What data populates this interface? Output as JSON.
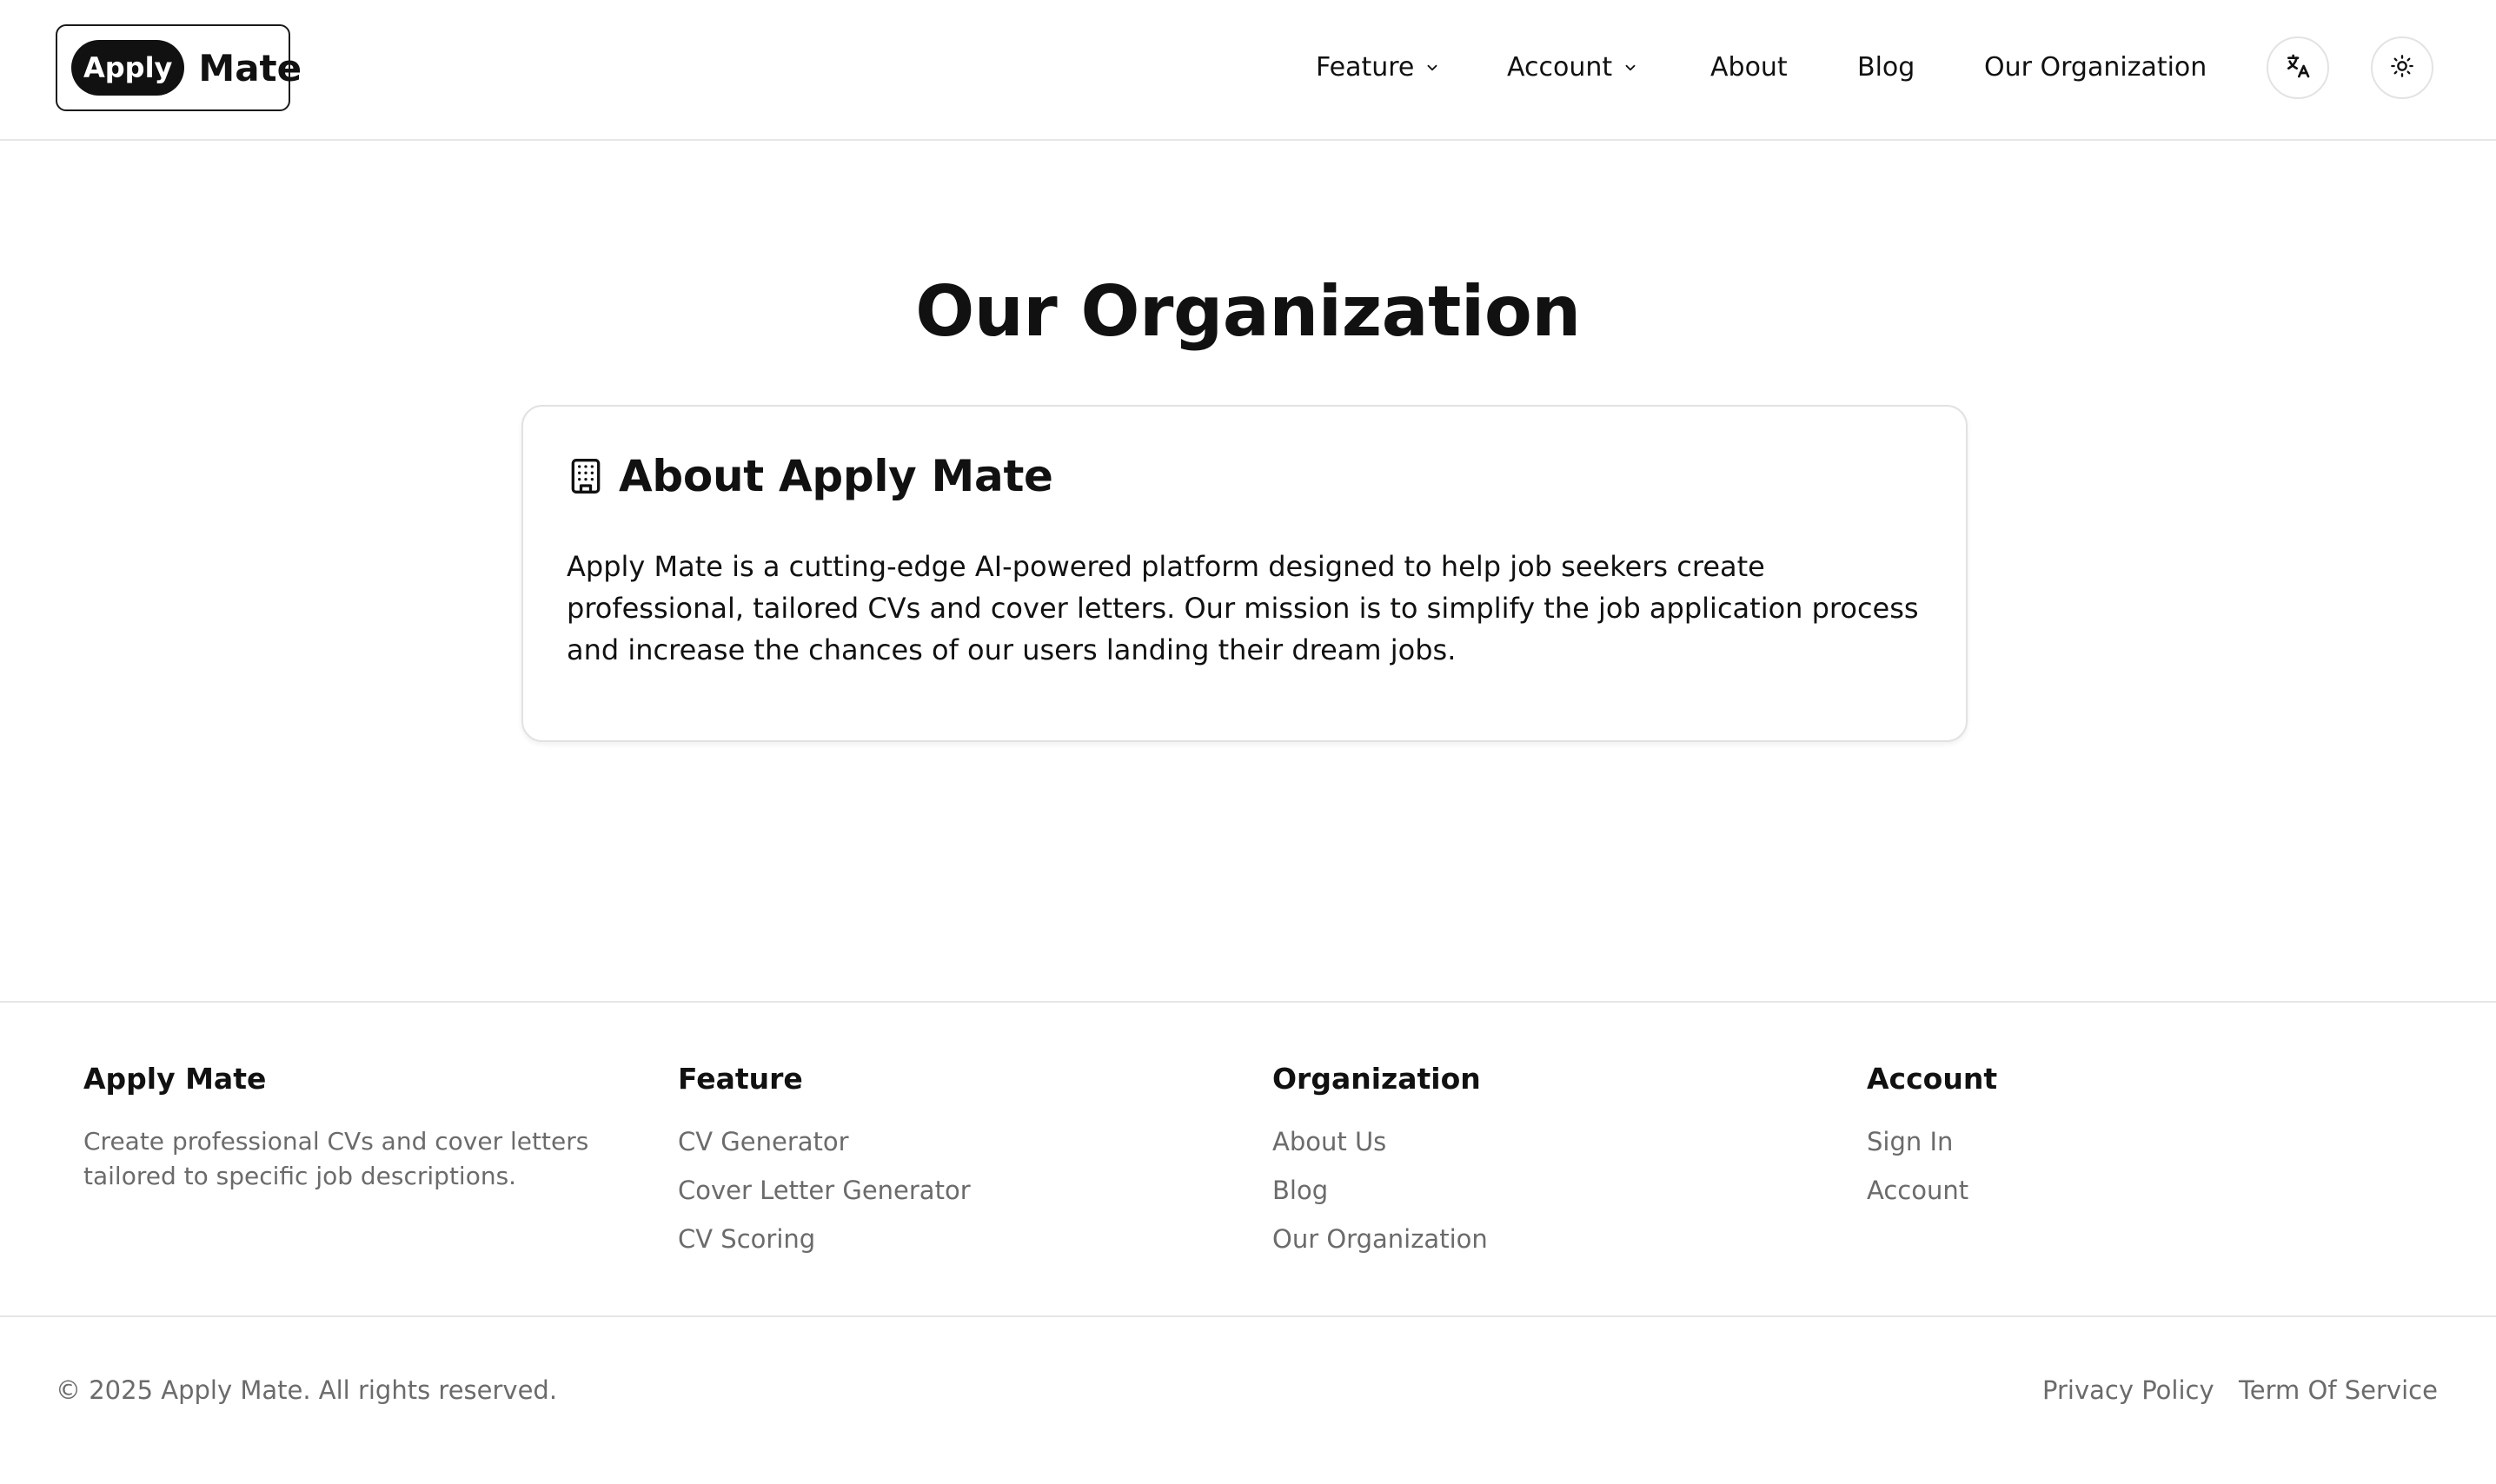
{
  "brand": {
    "pill": "Apply",
    "word": "Mate"
  },
  "nav": {
    "feature": "Feature",
    "account": "Account",
    "about": "About",
    "blog": "Blog",
    "organization": "Our Organization",
    "icons": {
      "translate": "translate-icon",
      "theme": "sun-icon",
      "dropdown": "chevron-down-icon"
    }
  },
  "main": {
    "title": "Our Organization",
    "card": {
      "icon": "building-icon",
      "title": "About Apply Mate",
      "body": "Apply Mate is a cutting-edge AI-powered platform designed to help job seekers create professional, tailored CVs and cover letters. Our mission is to simplify the job application process and increase the chances of our users landing their dream jobs."
    }
  },
  "footer": {
    "brand": {
      "title": "Apply Mate",
      "description": "Create professional CVs and cover letters tailored to specific job descriptions."
    },
    "feature": {
      "title": "Feature",
      "links": [
        "CV Generator",
        "Cover Letter Generator",
        "CV Scoring"
      ]
    },
    "organization": {
      "title": "Organization",
      "links": [
        "About Us",
        "Blog",
        "Our Organization"
      ]
    },
    "account": {
      "title": "Account",
      "links": [
        "Sign In",
        "Account"
      ]
    },
    "copyright": "© 2025 Apply Mate. All rights reserved.",
    "privacy": "Privacy Policy",
    "terms": "Term Of Service"
  }
}
